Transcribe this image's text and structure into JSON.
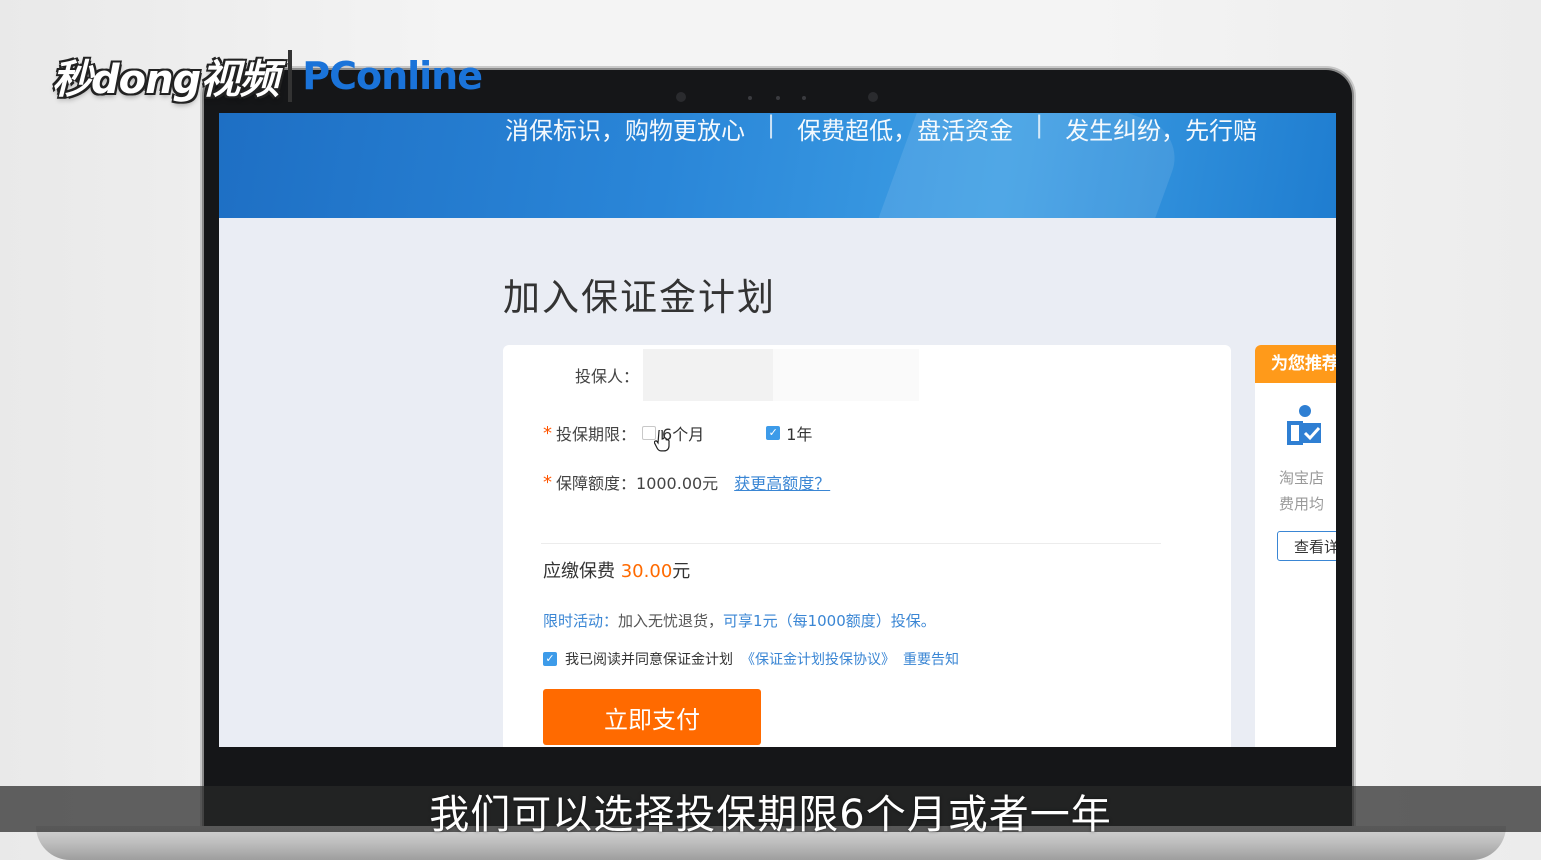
{
  "watermark": {
    "left": "秒dong视频",
    "right": "PConline"
  },
  "banner": {
    "slogans": [
      "消保标识，购物更放心",
      "保费超低，盘活资金",
      "发生纠纷，先行赔"
    ]
  },
  "page": {
    "title": "加入保证金计划"
  },
  "form": {
    "insured_label": "投保人：",
    "insured_value": "",
    "period_label": "投保期限：",
    "period_options": [
      {
        "label": "6个月",
        "checked": false
      },
      {
        "label": "1年",
        "checked": true
      }
    ],
    "coverage_label": "保障额度：",
    "coverage_value": "1000.00元",
    "coverage_link": "获更高额度？",
    "fee_label": "应缴保费",
    "fee_amount": "30.00",
    "fee_unit": "元",
    "promo_prefix": "限时活动：",
    "promo_mid": "加入无忧退货，",
    "promo_suffix": "可享1元（每1000额度）投保。",
    "agree_checked": true,
    "agree_text": "我已阅读并同意保证金计划",
    "agreement_link": "《保证金计划投保协议》",
    "notice_link": "重要告知",
    "pay_button": "立即支付"
  },
  "recommend": {
    "header": "为您推荐",
    "text_line1": "淘宝店",
    "text_line2": "费用均",
    "button": "查看详"
  },
  "subtitle": "我们可以选择投保期限6个月或者一年",
  "colors": {
    "accent_orange": "#ff6a00",
    "link_blue": "#3a86d4",
    "banner_blue": "#2a86d8",
    "recommend_orange": "#ff9a1a"
  }
}
